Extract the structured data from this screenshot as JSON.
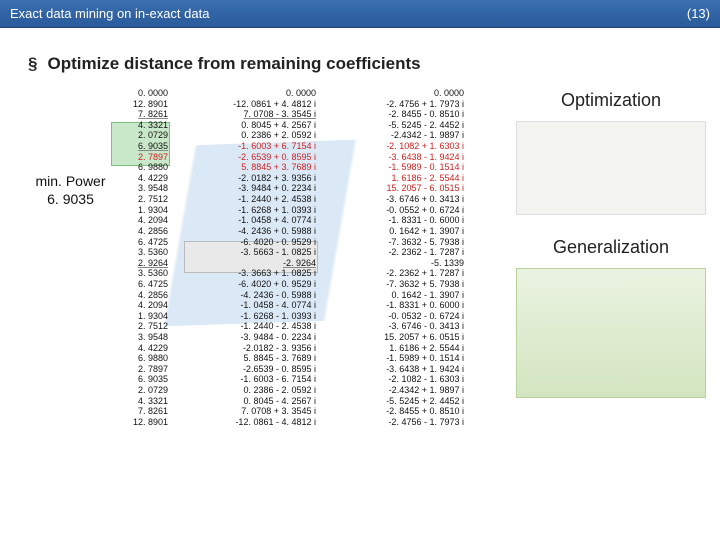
{
  "header": {
    "title": "Exact data mining on in-exact data",
    "page_label": "(13)"
  },
  "bullet": "Optimize distance from remaining coefficients",
  "minpower": {
    "label": "min. Power",
    "value": "6. 9035"
  },
  "col1": [
    "0. 0000",
    "12. 8901",
    "7. 8261",
    "4. 3321",
    "2. 0729",
    "6. 9035",
    "2. 7897",
    "6. 9880",
    "4. 4229",
    "3. 9548",
    "2. 7512",
    "1. 9304",
    "4. 2094",
    "4. 2856",
    "6. 4725",
    "3. 5360",
    "2. 9264",
    "3. 5360",
    "6. 4725",
    "4. 2856",
    "4. 2094",
    "1. 9304",
    "2. 7512",
    "3. 9548",
    "4. 4229",
    "6. 9880",
    "2. 7897",
    "6. 9035",
    "2. 0729",
    "4. 3321",
    "7. 8261",
    "12. 8901"
  ],
  "col2": [
    "0. 0000",
    "-12. 0861 + 4. 4812 i",
    "7. 0708 - 3. 3545 i",
    "0. 8045 + 4. 2567 i",
    "0. 2386 + 2. 0592 i",
    "-1. 6003 + 6. 7154 i",
    "-2. 6539 + 0. 8595 i",
    "5. 8845 + 3. 7689 i",
    "-2. 0182 + 3. 9356 i",
    "-3. 9484 + 0. 2234 i",
    "-1. 2440 + 2. 4538 i",
    "-1. 6268 + 1. 0393 i",
    "-1. 0458 + 4. 0774 i",
    "-4. 2436 + 0. 5988 i",
    "-6. 4020 - 0. 9529 i",
    "-3. 5663 - 1. 0825 i",
    "-2. 9264",
    "-3. 3663 + 1. 0825 i",
    "-6. 4020 + 0. 9529 i",
    "-4. 2436 - 0. 5988 i",
    "-1. 0458 - 4. 0774 i",
    "-1. 6268 - 1. 0393 i",
    "-1. 2440 - 2. 4538 i",
    "-3. 9484 - 0. 2234 i",
    "-2.0182 - 3. 9356 i",
    "5. 8845 - 3. 7689 i",
    "-2.6539 - 0. 8595 i",
    "-1. 6003 - 6. 7154 i",
    "0. 2386 - 2. 0592 i",
    "0. 8045 - 4. 2567 i",
    "7. 0708 + 3. 3545 i",
    "-12. 0861 - 4. 4812 i"
  ],
  "col3": [
    "0. 0000",
    "-2. 4756 + 1. 7973 i",
    "-2. 8455 - 0. 8510 i",
    "-5. 5245 - 2. 4452 i",
    "-2.4342 - 1. 9897 i",
    "-2. 1082 + 1. 6303 i",
    "-3. 6438 - 1. 9424 i",
    "-1. 5989 - 0. 1514 i",
    "1. 6186 - 2. 5544 i",
    "15. 2057 - 6. 0515 i",
    "-3. 6746 + 0. 3413 i",
    "-0. 0552 + 0. 6724 i",
    "-1. 8331 - 0. 6000 i",
    "0. 1642 + 1. 3907 i",
    "-7. 3632 - 5. 7938 i",
    "-2. 2362 - 1. 7287 i",
    "-5. 1339",
    "-2. 2362 + 1. 7287 i",
    "-7. 3632 + 5. 7938 i",
    "0. 1642 - 1. 3907 i",
    "-1. 8331 + 0. 6000 i",
    "-0. 0532 - 0. 6724 i",
    "-3. 6746 - 0. 3413 i",
    "15. 2057 + 6. 0515 i",
    "1. 6186 + 2. 5544 i",
    "-1. 5989 + 0. 1514 i",
    "-3. 6438 + 1. 9424 i",
    "-2. 1082 - 1. 6303 i",
    "-2.4342 + 1. 9897 i",
    "-5. 5245 + 2. 4452 i",
    "-2. 8455 + 0. 8510 i",
    "-2. 4756 - 1. 7973 i"
  ],
  "captions": {
    "opt": "Optimization",
    "gen": "Generalization"
  }
}
